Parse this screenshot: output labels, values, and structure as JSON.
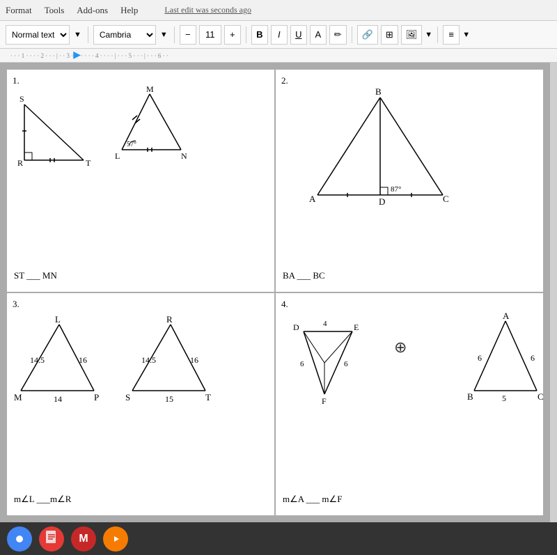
{
  "menubar": {
    "items": [
      "Format",
      "Tools",
      "Add-ons",
      "Help"
    ],
    "last_edit": "Last edit was seconds ago"
  },
  "toolbar": {
    "style_label": "Normal text",
    "font_label": "Cambria",
    "font_size": "11",
    "bold_label": "B",
    "italic_label": "I",
    "underline_label": "U"
  },
  "cells": [
    {
      "number": "1.",
      "problem": "ST ___ MN"
    },
    {
      "number": "2.",
      "problem": "BA ___ BC"
    },
    {
      "number": "3.",
      "problem": "m∠L ___m∠R"
    },
    {
      "number": "4.",
      "problem": "m∠A ___ m∠F"
    }
  ]
}
